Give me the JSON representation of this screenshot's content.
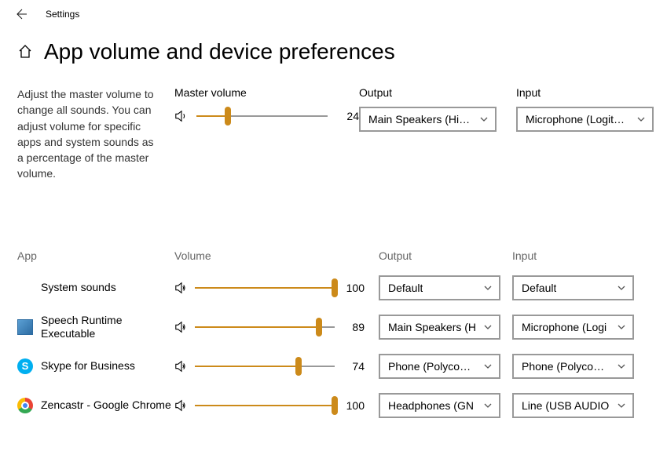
{
  "titlebar": {
    "title": "Settings"
  },
  "page": {
    "heading": "App volume and device preferences",
    "description": "Adjust the master volume to change all sounds. You can adjust volume for specific apps and system sounds as a percentage of the master volume."
  },
  "master": {
    "label": "Master volume",
    "volume": 24,
    "outputLabel": "Output",
    "outputValue": "Main Speakers (Hi…",
    "inputLabel": "Input",
    "inputValue": "Microphone (Logit…"
  },
  "appsHeader": {
    "app": "App",
    "volume": "Volume",
    "output": "Output",
    "input": "Input"
  },
  "apps": [
    {
      "name": "System sounds",
      "icon": "blank",
      "volume": 100,
      "output": "Default",
      "input": "Default"
    },
    {
      "name": "Speech Runtime Executable",
      "icon": "speech",
      "volume": 89,
      "output": "Main Speakers (H",
      "input": "Microphone (Logi"
    },
    {
      "name": "Skype for Business",
      "icon": "skype",
      "volume": 74,
      "output": "Phone (Polycom C",
      "input": "Phone (Polycom C"
    },
    {
      "name": "Zencastr - Google Chrome",
      "icon": "chrome",
      "volume": 100,
      "output": "Headphones (GN",
      "input": "Line (USB AUDIO"
    }
  ]
}
